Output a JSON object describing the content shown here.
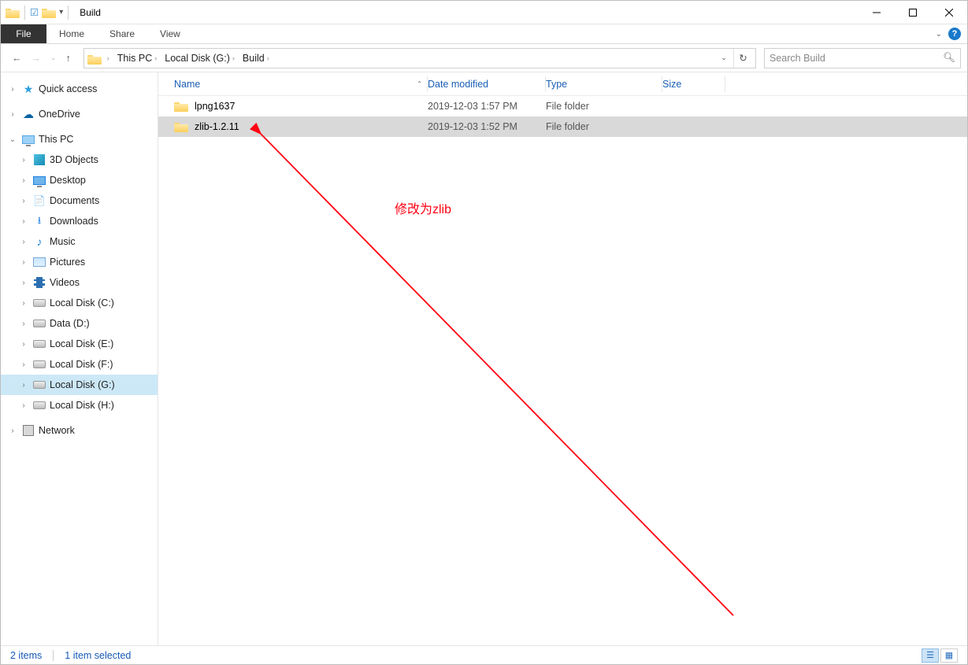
{
  "title": "Build",
  "ribbon": {
    "file": "File",
    "home": "Home",
    "share": "Share",
    "view": "View"
  },
  "help_tooltip": "?",
  "breadcrumb": [
    {
      "label": "This PC"
    },
    {
      "label": "Local Disk (G:)"
    },
    {
      "label": "Build"
    }
  ],
  "search_placeholder": "Search Build",
  "tree": {
    "quick": "Quick access",
    "onedrive": "OneDrive",
    "thispc": "This PC",
    "items": [
      {
        "label": "3D Objects"
      },
      {
        "label": "Desktop"
      },
      {
        "label": "Documents"
      },
      {
        "label": "Downloads"
      },
      {
        "label": "Music"
      },
      {
        "label": "Pictures"
      },
      {
        "label": "Videos"
      },
      {
        "label": "Local Disk (C:)"
      },
      {
        "label": "Data (D:)"
      },
      {
        "label": "Local Disk (E:)"
      },
      {
        "label": "Local Disk (F:)"
      },
      {
        "label": "Local Disk (G:)"
      },
      {
        "label": "Local Disk (H:)"
      }
    ],
    "network": "Network"
  },
  "columns": {
    "name": "Name",
    "date": "Date modified",
    "type": "Type",
    "size": "Size"
  },
  "rows": [
    {
      "name": "lpng1637",
      "date": "2019-12-03 1:57 PM",
      "type": "File folder",
      "size": ""
    },
    {
      "name": "zlib-1.2.11",
      "date": "2019-12-03 1:52 PM",
      "type": "File folder",
      "size": ""
    }
  ],
  "annotation": "修改为zlib",
  "status": {
    "items": "2 items",
    "selected": "1 item selected"
  }
}
